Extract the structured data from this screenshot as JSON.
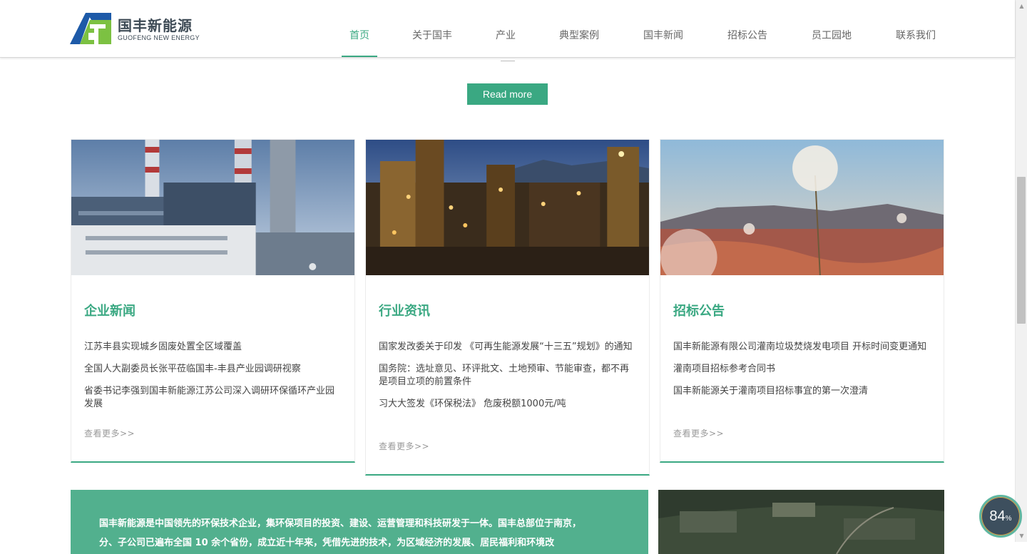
{
  "header": {
    "logo_cn": "国丰新能源",
    "logo_en": "GUOFENG NEW ENERGY",
    "nav": [
      {
        "label": "首页",
        "active": true
      },
      {
        "label": "关于国丰",
        "active": false
      },
      {
        "label": "产业",
        "active": false
      },
      {
        "label": "典型案例",
        "active": false
      },
      {
        "label": "国丰新闻",
        "active": false
      },
      {
        "label": "招标公告",
        "active": false
      },
      {
        "label": "员工园地",
        "active": false
      },
      {
        "label": "联系我们",
        "active": false
      }
    ]
  },
  "read_more": "Read more",
  "cards": [
    {
      "title": "企业新闻",
      "items": [
        "江苏丰县实现城乡固废处置全区域覆盖",
        "全国人大副委员长张平莅临国丰-丰县产业园调研视察",
        "省委书记李强到国丰新能源江苏公司深入调研环保循环产业园发展"
      ],
      "more": "查看更多>>"
    },
    {
      "title": "行业资讯",
      "items": [
        "国家发改委关于印发 《可再生能源发展“十三五”规划》的通知",
        "国务院：选址意见、环评批文、土地预审、节能审查，都不再是项目立项的前置条件",
        "习大大签发《环保税法》 危废税额1000元/吨"
      ],
      "more": "查看更多>>"
    },
    {
      "title": "招标公告",
      "items": [
        "国丰新能源有限公司灌南垃圾焚烧发电项目 开标时间变更通知",
        "灌南项目招标参考合同书",
        "国丰新能源关于灌南项目招标事宜的第一次澄清"
      ],
      "more": "查看更多>>"
    }
  ],
  "about": {
    "text": "国丰新能源是中国领先的环保技术企业，集环保项目的投资、建设、运营管理和科技研发于一体。国丰总部位于南京，分、子公司已遍布全国 10 余个省份，成立近十年来，凭借先进的技术，为区域经济的发展、居民福利和环境改"
  },
  "speed": {
    "value": "84",
    "unit": "%"
  },
  "colors": {
    "accent": "#3aa882",
    "about_bg": "#52b08e",
    "logo_blue": "#1d5aa8",
    "logo_green": "#7cc142"
  },
  "icons": {
    "logo": "guofeng-logo-icon",
    "scroll_up": "scroll-up-arrow-icon",
    "scroll_down": "scroll-down-arrow-icon"
  }
}
